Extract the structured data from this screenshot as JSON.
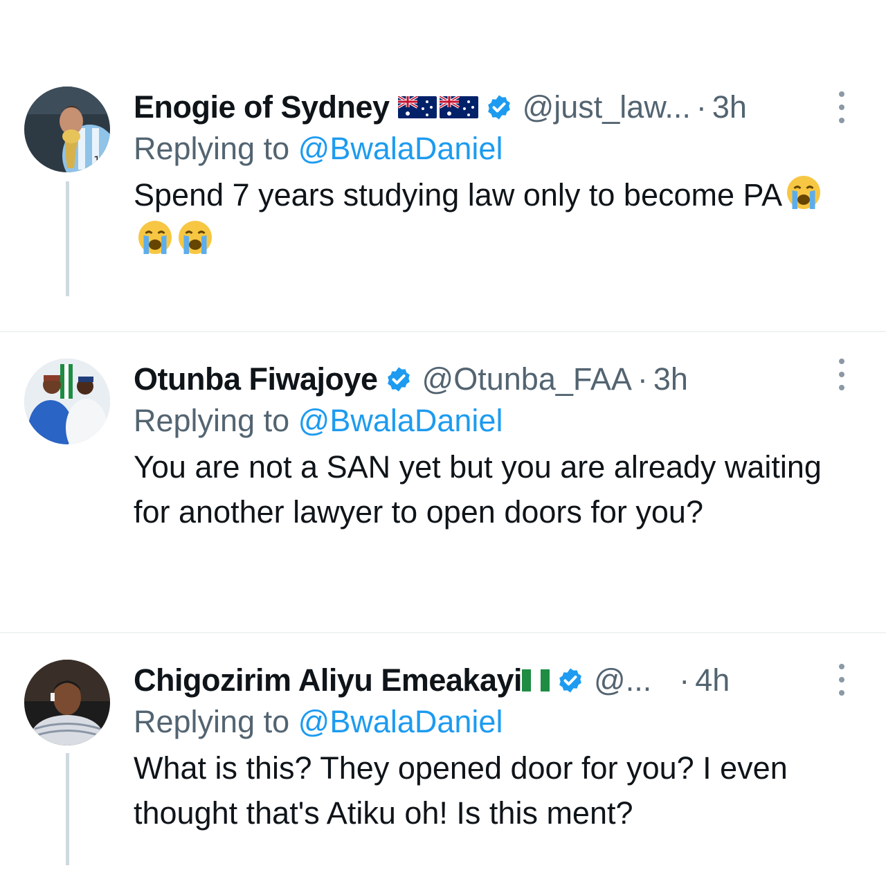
{
  "replies": [
    {
      "name": "Enogie of Sydney",
      "flags": [
        "australia-flag",
        "australia-flag"
      ],
      "handle": "@just_law...",
      "dot": "·",
      "time": "3h",
      "replying_prefix": "Replying to ",
      "replying_to": "@BwalaDaniel",
      "text": "Spend 7 years studying law only to become PA",
      "emojis": [
        "loudly-crying-face",
        "loudly-crying-face",
        "loudly-crying-face"
      ]
    },
    {
      "name": "Otunba Fiwajoye",
      "handle": "@Otunba_FAA",
      "dot": "·",
      "time": "3h",
      "replying_prefix": "Replying to ",
      "replying_to": "@BwalaDaniel",
      "text": "You are not a SAN yet but you are already waiting for another lawyer to open doors for you?"
    },
    {
      "name": "Chigozirim Aliyu Emeakayi",
      "flags": [
        "nigeria-flag"
      ],
      "handle": "@...",
      "dot": "·",
      "time": "4h",
      "replying_prefix": "Replying to ",
      "replying_to": "@BwalaDaniel",
      "text": "What is this? They opened door for you? I even thought that's Atiku oh! Is this ment?"
    }
  ],
  "colors": {
    "text": "#0f1419",
    "secondary": "#536471",
    "link": "#1d9bf0",
    "verified": "#1d9bf0",
    "divider": "#eff3f4",
    "thread_line": "#cfd9de"
  },
  "icons": {
    "verified": "verified-badge-icon",
    "more": "more-options-icon"
  }
}
